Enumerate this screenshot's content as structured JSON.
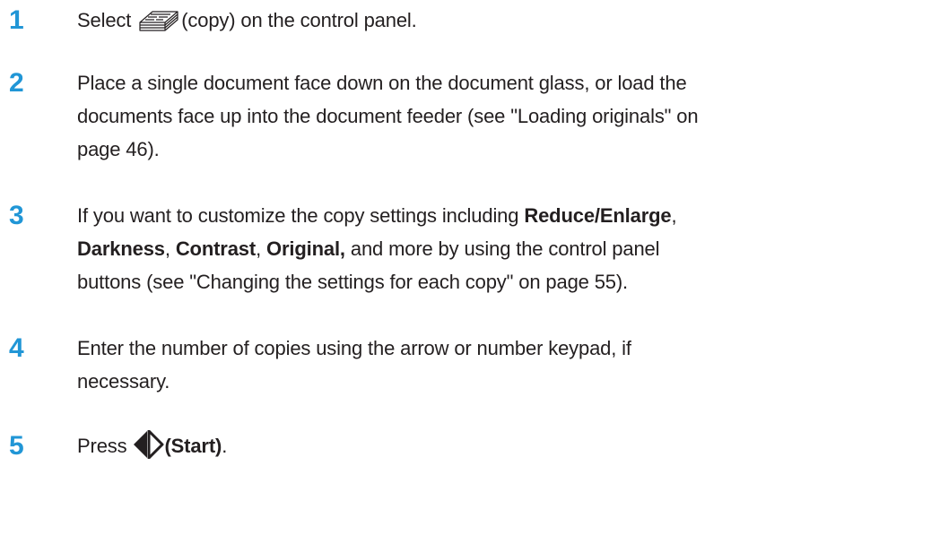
{
  "steps": [
    {
      "number": "1",
      "text_before": "Select ",
      "icon": "copy-icon",
      "text_after": "(copy) on the control panel."
    },
    {
      "number": "2",
      "line1": "Place a single document face down on the document glass, or load the",
      "line2": "documents face up into the document feeder (see \"Loading originals\" on",
      "line3": "page 46)."
    },
    {
      "number": "3",
      "t1": "If you want to customize the copy settings including ",
      "b1": "Reduce/Enlarge",
      "t2": ",",
      "b2": "Darkness",
      "t3": ", ",
      "b3": "Contrast",
      "t4": ", ",
      "b4": "Original,",
      "t5": " and more by using the control panel",
      "line3": "buttons (see \"Changing the settings for each copy\" on page 55)."
    },
    {
      "number": "4",
      "line1": "Enter the number of copies using the arrow or number keypad, if",
      "line2": "necessary."
    },
    {
      "number": "5",
      "text_before": "Press ",
      "icon": "start-icon",
      "bold": "(Start)",
      "text_after": "."
    }
  ],
  "colors": {
    "step_number": "#2196d6",
    "body_text": "#231f20"
  }
}
